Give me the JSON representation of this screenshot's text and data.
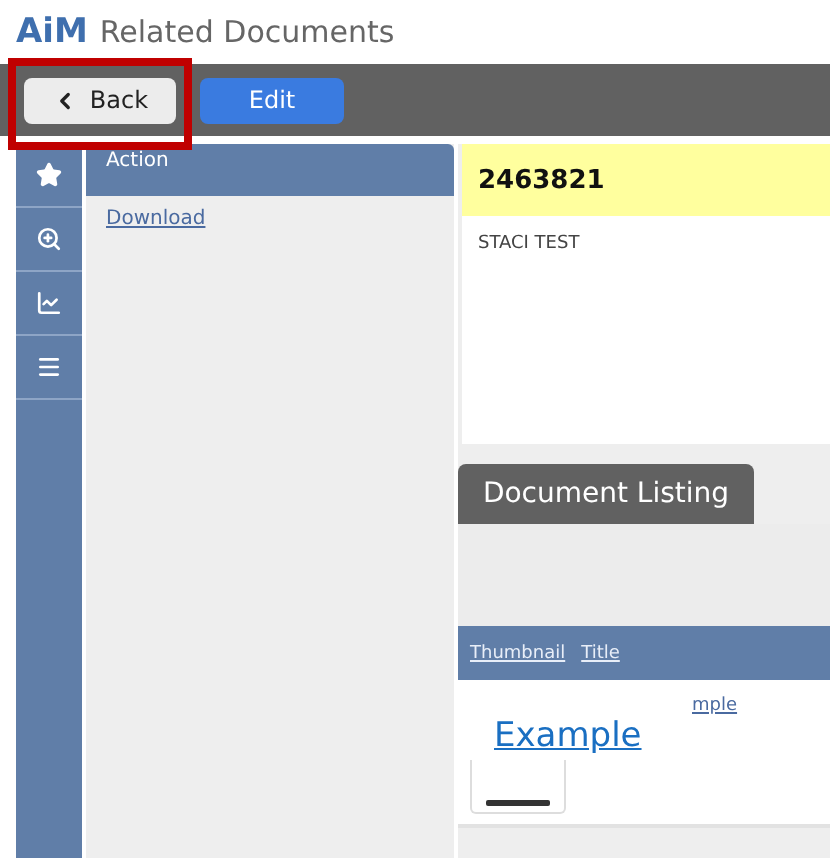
{
  "app": {
    "logo": "AiM",
    "title": "Related Documents"
  },
  "toolbar": {
    "buttons": [
      {
        "label": "Back",
        "kind": "back",
        "highlighted": true
      },
      {
        "label": "Edit",
        "kind": "primary",
        "highlighted": false
      }
    ]
  },
  "action_panel": {
    "header": "Action",
    "links": [
      "Download"
    ]
  },
  "record": {
    "number": "2463821",
    "description": "STACI TEST"
  },
  "tabs": [
    {
      "label": "Document Listing",
      "selected": true
    }
  ],
  "listing": {
    "columns": [
      "Thumbnail",
      "Title"
    ],
    "rows": [
      {
        "title": "mple"
      }
    ]
  },
  "callout": {
    "text": "Example"
  }
}
